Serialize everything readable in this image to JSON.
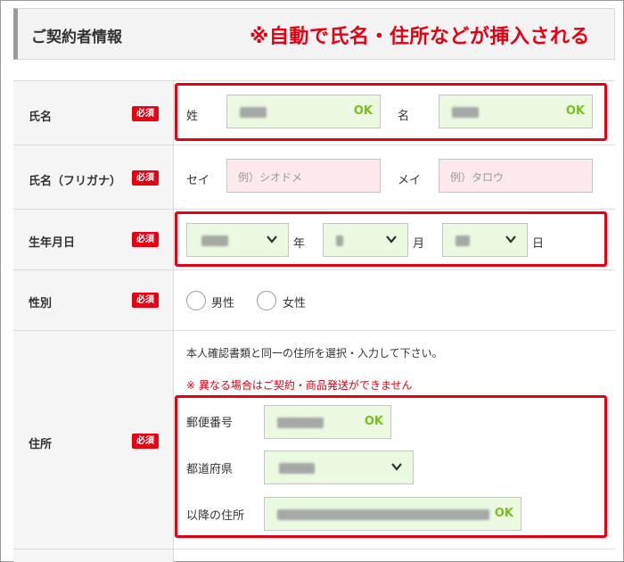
{
  "header": {
    "title": "ご契約者情報",
    "auto_note": "※自動で氏名・住所などが挿入される"
  },
  "colors": {
    "accent_red": "#e60012",
    "ok_green": "#7bbf1e",
    "filled_bg": "#eaf9e0",
    "empty_bg": "#fde8ec"
  },
  "form": {
    "required_badge": "必須",
    "name": {
      "label": "氏名",
      "last_label": "姓",
      "first_label": "名",
      "last_status": "OK",
      "first_status": "OK"
    },
    "kana": {
      "label": "氏名（フリガナ）",
      "sei_label": "セイ",
      "mei_label": "メイ",
      "sei_placeholder": "例）シオドメ",
      "mei_placeholder": "例）タロウ"
    },
    "birth": {
      "label": "生年月日",
      "year_suffix": "年",
      "month_suffix": "月",
      "day_suffix": "日"
    },
    "gender": {
      "label": "性別",
      "male": "男性",
      "female": "女性"
    },
    "address": {
      "label": "住所",
      "instruction": "本人確認書類と同一の住所を選択・入力して下さい。",
      "warning": "※ 異なる場合はご契約・商品発送ができません",
      "postal_label": "郵便番号",
      "postal_status": "OK",
      "prefecture_label": "都道府県",
      "street_label": "以降の住所",
      "street_status": "OK"
    }
  }
}
